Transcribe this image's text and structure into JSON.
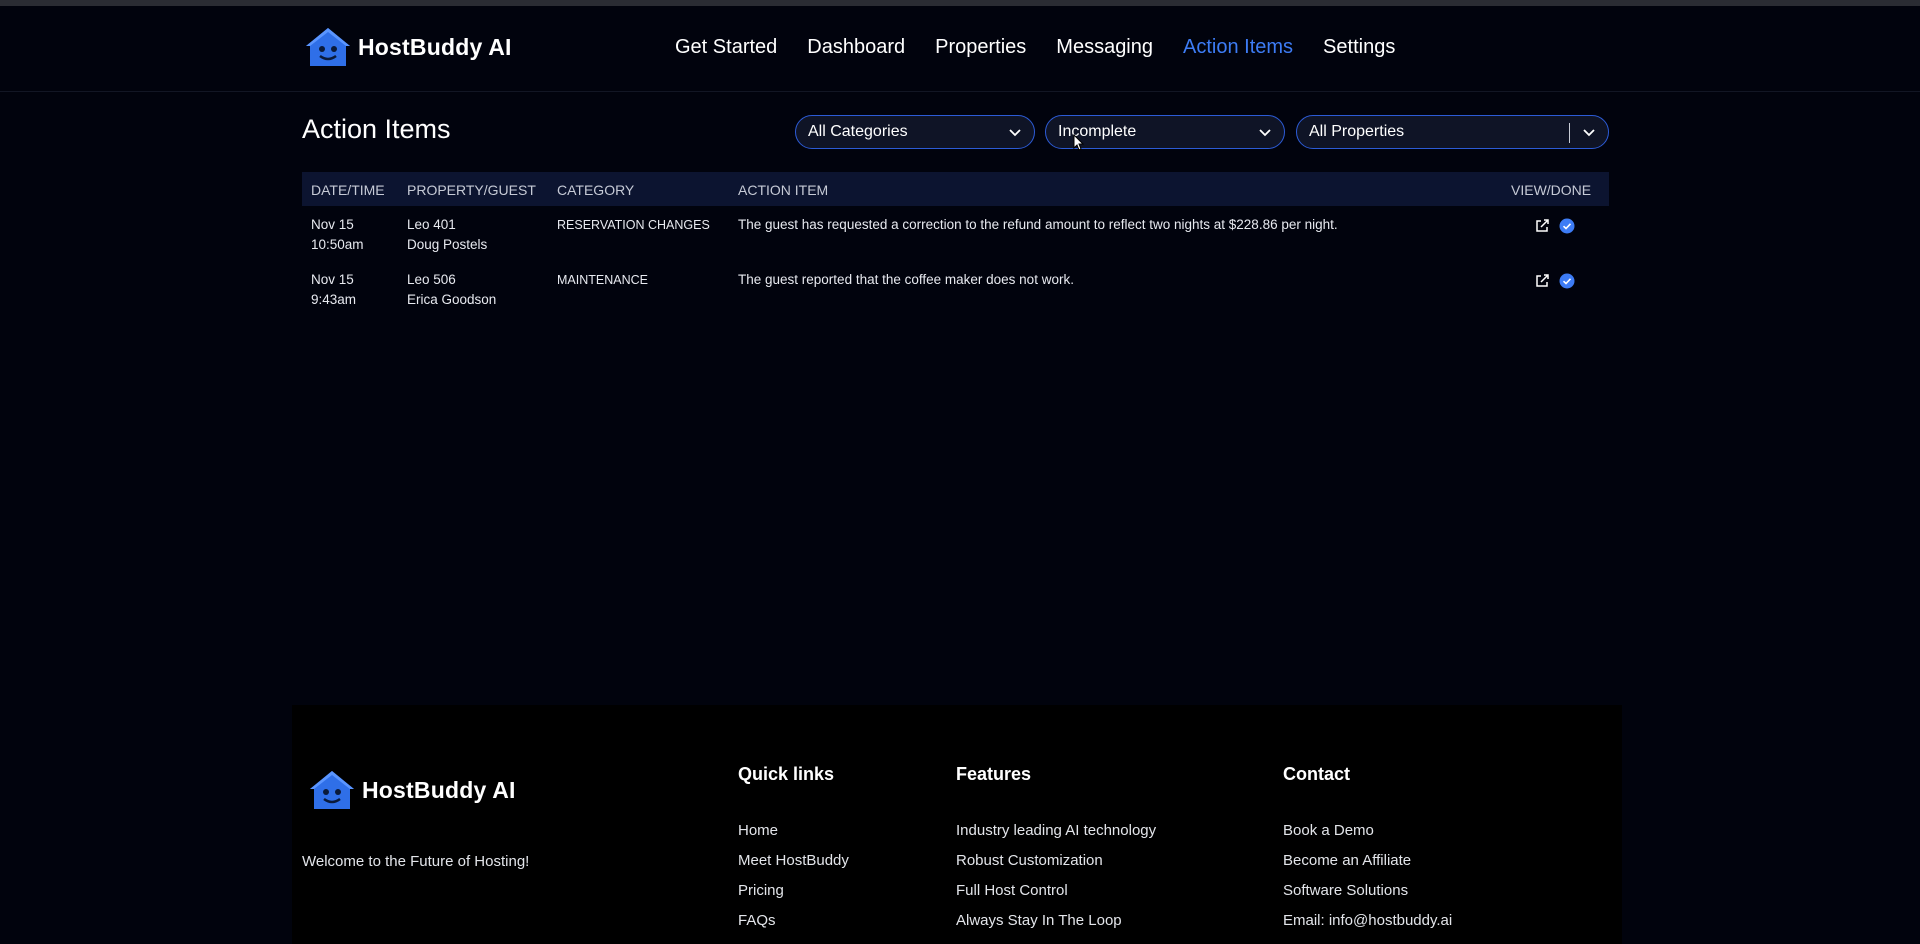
{
  "brand": {
    "name": "HostBuddy AI",
    "accent": "#3d7cf5"
  },
  "nav": {
    "items": [
      {
        "label": "Get Started",
        "active": false
      },
      {
        "label": "Dashboard",
        "active": false
      },
      {
        "label": "Properties",
        "active": false
      },
      {
        "label": "Messaging",
        "active": false
      },
      {
        "label": "Action Items",
        "active": true
      },
      {
        "label": "Settings",
        "active": false
      }
    ]
  },
  "page": {
    "title": "Action Items"
  },
  "filters": {
    "category": "All Categories",
    "status": "Incomplete",
    "properties": "All Properties"
  },
  "table": {
    "headers": [
      "DATE/TIME",
      "PROPERTY/GUEST",
      "CATEGORY",
      "ACTION ITEM",
      "VIEW/DONE"
    ],
    "rows": [
      {
        "date": "Nov 15",
        "time": "10:50am",
        "property": "Leo 401",
        "guest": "Doug Postels",
        "category": "RESERVATION CHANGES",
        "action": "The guest has requested a correction to the refund amount to reflect two nights at $228.86 per night."
      },
      {
        "date": "Nov 15",
        "time": "9:43am",
        "property": "Leo 506",
        "guest": "Erica Goodson",
        "category": "MAINTENANCE",
        "action": "The guest reported that the coffee maker does not work."
      }
    ]
  },
  "footer": {
    "brand": "HostBuddy AI",
    "tagline": "Welcome to the Future of Hosting!",
    "quick_links": {
      "title": "Quick links",
      "items": [
        "Home",
        "Meet HostBuddy",
        "Pricing",
        "FAQs"
      ]
    },
    "features": {
      "title": "Features",
      "items": [
        "Industry leading AI technology",
        "Robust Customization",
        "Full Host Control",
        "Always Stay In The Loop"
      ]
    },
    "contact": {
      "title": "Contact",
      "items": [
        "Book a Demo",
        "Become an Affiliate",
        "Software Solutions",
        "Email: info@hostbuddy.ai"
      ]
    }
  }
}
